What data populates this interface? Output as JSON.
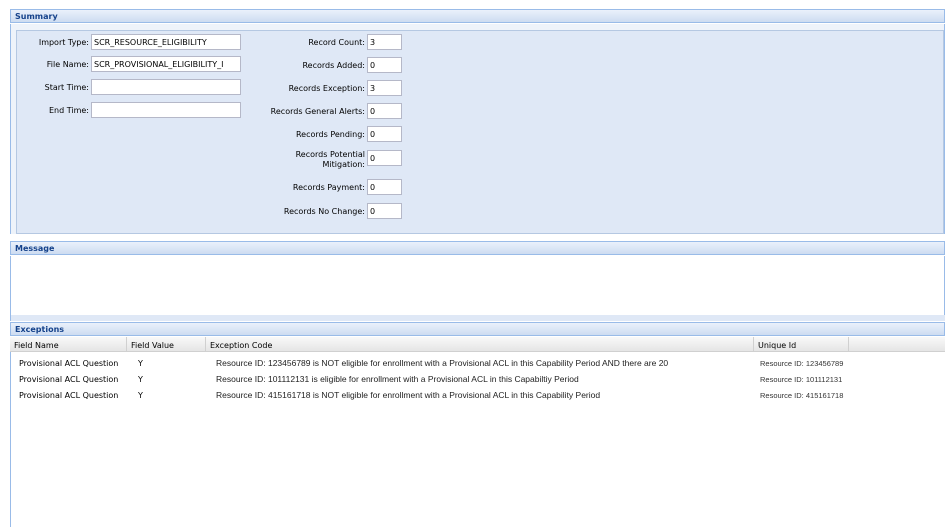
{
  "summary": {
    "title": "Summary",
    "import_type_label": "Import Type:",
    "import_type_value": "SCR_RESOURCE_ELIGIBILITY",
    "file_name_label": "File Name:",
    "file_name_value": "SCR_PROVISIONAL_ELIGIBILITY_I",
    "start_time_label": "Start Time:",
    "start_time_value": "",
    "end_time_label": "End Time:",
    "end_time_value": "",
    "record_count_label": "Record Count:",
    "record_count_value": "3",
    "records_added_label": "Records Added:",
    "records_added_value": "0",
    "records_exception_label": "Records Exception:",
    "records_exception_value": "3",
    "records_general_alerts_label": "Records General Alerts:",
    "records_general_alerts_value": "0",
    "records_pending_label": "Records Pending:",
    "records_pending_value": "0",
    "records_potential_mitigation_label_1": "Records Potential",
    "records_potential_mitigation_label_2": "Mitigation:",
    "records_potential_mitigation_value": "0",
    "records_payment_label": "Records Payment:",
    "records_payment_value": "0",
    "records_no_change_label": "Records No Change:",
    "records_no_change_value": "0"
  },
  "message": {
    "title": "Message",
    "text": ""
  },
  "exceptions": {
    "title": "Exceptions",
    "columns": {
      "field_name": "Field Name",
      "field_value": "Field Value",
      "exception_code": "Exception Code",
      "unique_id": "Unique Id"
    },
    "rows": [
      {
        "field_name": "Provisional ACL Question",
        "field_value": "Y",
        "exception_code": "Resource ID: 123456789 is NOT eligible for enrollment with a Provisional ACL in this Capability Period AND there are 20",
        "unique_id": "Resource ID: 123456789"
      },
      {
        "field_name": "Provisional ACL Question",
        "field_value": "Y",
        "exception_code": "Resource ID: 101112131  is eligible for enrollment with a Provisional ACL in this Capabiltiy Period",
        "unique_id": "Resource ID: 101112131"
      },
      {
        "field_name": "Provisional ACL Question",
        "field_value": "Y",
        "exception_code": "Resource ID: 415161718 is NOT eligible for enrollment with a Provisional ACL in this Capability Period",
        "unique_id": "Resource ID: 415161718"
      }
    ]
  }
}
